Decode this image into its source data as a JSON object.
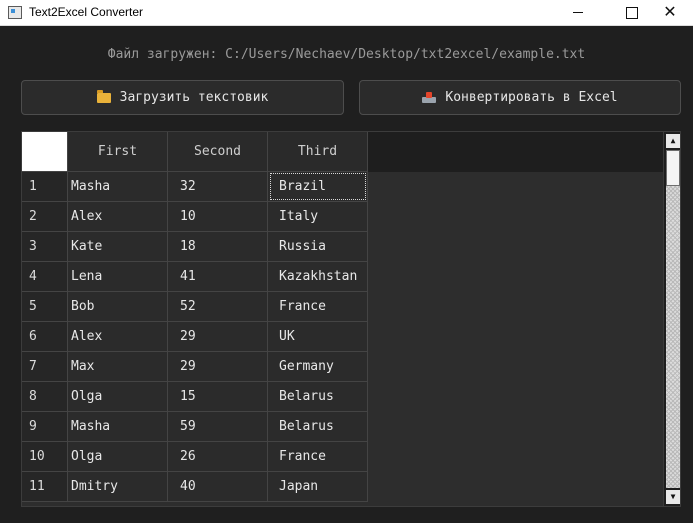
{
  "window": {
    "title": "Text2Excel Converter",
    "close_glyph": "✕"
  },
  "status": {
    "text": "Файл загружен: C:/Users/Nechaev/Desktop/txt2excel/example.txt"
  },
  "buttons": {
    "load_label": "Загрузить текстовик",
    "load_icon": "folder-icon",
    "convert_label": "Конвертировать в Excel",
    "convert_icon": "export-icon"
  },
  "table": {
    "columns": [
      "First",
      "Second",
      "Third"
    ],
    "rows": [
      [
        "1",
        "Masha",
        "32",
        "Brazil"
      ],
      [
        "2",
        "Alex",
        "10",
        "Italy"
      ],
      [
        "3",
        "Kate",
        "18",
        "Russia"
      ],
      [
        "4",
        "Lena",
        "41",
        "Kazakhstan"
      ],
      [
        "5",
        "Bob",
        "52",
        "France"
      ],
      [
        "6",
        "Alex",
        "29",
        "UK"
      ],
      [
        "7",
        "Max",
        "29",
        "Germany"
      ],
      [
        "8",
        "Olga",
        "15",
        "Belarus"
      ],
      [
        "9",
        "Masha",
        "59",
        "Belarus"
      ],
      [
        "10",
        "Olga",
        "26",
        "France"
      ],
      [
        "11",
        "Dmitry",
        "40",
        "Japan"
      ]
    ],
    "focused_cell": "row 1, Third"
  },
  "scrollbar": {
    "up_glyph": "▲",
    "down_glyph": "▼"
  }
}
